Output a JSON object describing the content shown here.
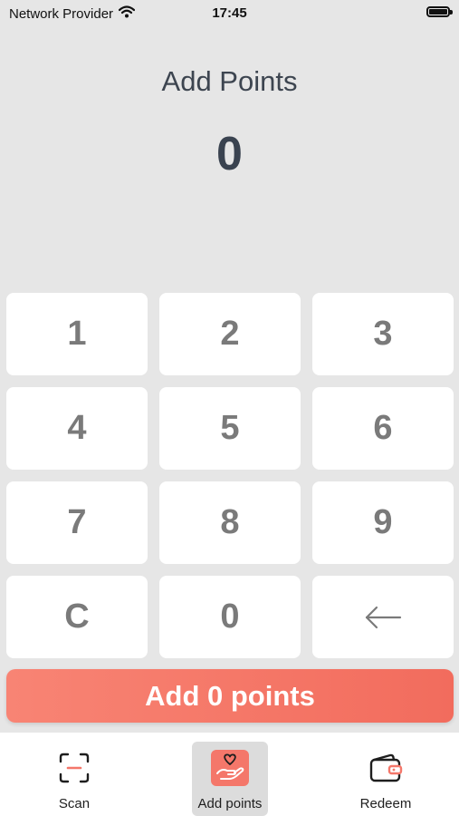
{
  "status": {
    "carrier": "Network Provider",
    "time": "17:45"
  },
  "page": {
    "title": "Add Points",
    "amount": "0"
  },
  "keypad": {
    "keys": [
      "1",
      "2",
      "3",
      "4",
      "5",
      "6",
      "7",
      "8",
      "9",
      "C",
      "0"
    ],
    "backspace_icon": "arrow-left-icon"
  },
  "submit": {
    "label": "Add 0 points",
    "color_start": "#f88474",
    "color_end": "#f26c5d"
  },
  "tabs": [
    {
      "label": "Scan",
      "icon": "scan-icon"
    },
    {
      "label": "Add points",
      "icon": "hand-heart-icon",
      "active": true
    },
    {
      "label": "Redeem",
      "icon": "wallet-icon"
    }
  ],
  "colors": {
    "background": "#e6e6e6",
    "accent": "#f4776a",
    "text": "#3d4550"
  }
}
